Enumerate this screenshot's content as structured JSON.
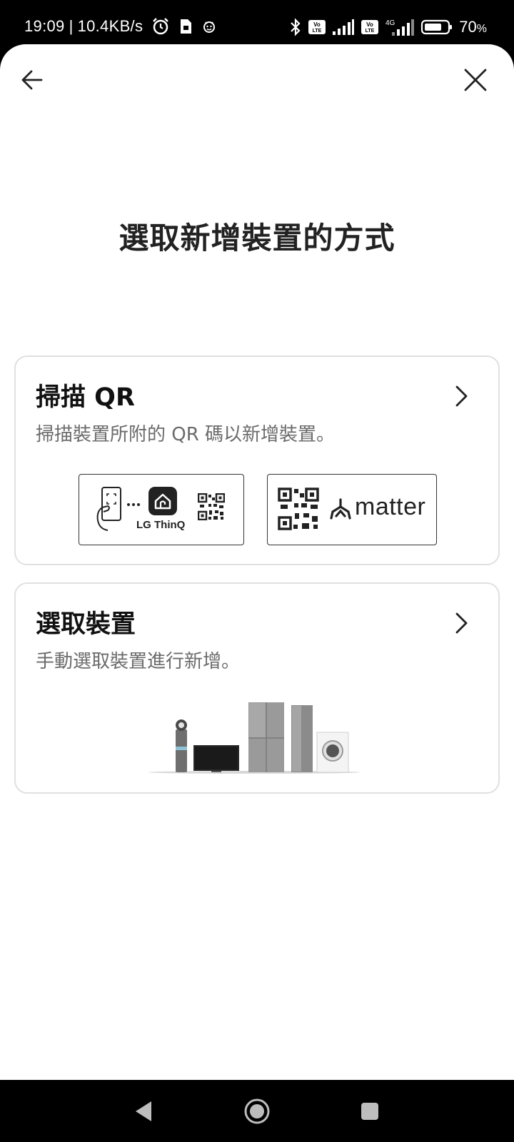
{
  "status_bar": {
    "time": "19:09",
    "separator": "|",
    "network_speed": "10.4KB/s",
    "battery_percent": "70",
    "battery_unit": "%",
    "left_icons": [
      "alarm-icon",
      "sim-card-icon",
      "face-icon"
    ],
    "right_icons": [
      "bluetooth-icon",
      "volte-icon",
      "signal-icon",
      "volte-icon",
      "4g-signal-icon",
      "battery-icon"
    ],
    "network_type": "4G",
    "volte_label": "Vo"
  },
  "nav": {
    "back_icon": "arrow-left-icon",
    "close_icon": "close-icon"
  },
  "page": {
    "title": "選取新增裝置的方式"
  },
  "options": {
    "scan_qr": {
      "title": "掃描 QR",
      "description": "掃描裝置所附的 QR 碼以新增裝置。",
      "thinq_badge_label": "LG ThinQ",
      "matter_badge_label": "matter"
    },
    "select_device": {
      "title": "選取裝置",
      "description": "手動選取裝置進行新增。"
    }
  },
  "system_nav": {
    "icons": [
      "back-triangle-icon",
      "home-circle-icon",
      "recents-square-icon"
    ]
  },
  "colors": {
    "background": "#ffffff",
    "card_border": "#e0e0e0",
    "title_text": "#222222",
    "desc_text": "#6b6b6b",
    "system_bar": "#000000"
  }
}
